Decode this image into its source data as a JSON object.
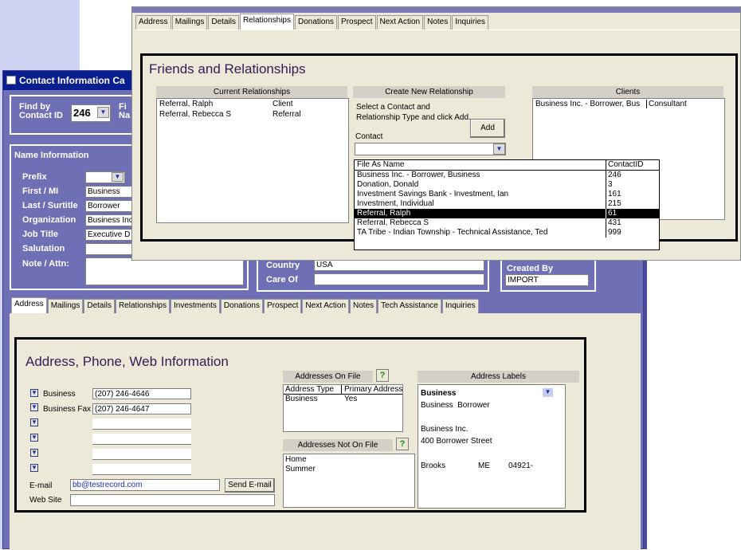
{
  "back_window": {
    "title": "Contact Information Ca",
    "find_by_label": "Find by\nContact ID",
    "find_by_value": "246",
    "find_by_name_label": "Fi\nNa",
    "name_section_title": "Name Information",
    "fields": [
      {
        "label": "Prefix",
        "value": ""
      },
      {
        "label": "First / MI",
        "value": "Business"
      },
      {
        "label": "Last / Surtitle",
        "value": "Borrower"
      },
      {
        "label": "Organization",
        "value": "Business Inc"
      },
      {
        "label": "Job Title",
        "value": "Executive D"
      },
      {
        "label": "Salutation",
        "value": ""
      },
      {
        "label": "Note / Attn:",
        "value": ""
      }
    ],
    "country_label": "Country",
    "country_value": "USA",
    "care_of_label": "Care Of",
    "care_of_value": "",
    "created_by_label": "Created By",
    "created_by_value": "IMPORT",
    "tabs": [
      "Address",
      "Mailings",
      "Details",
      "Relationships",
      "Investments",
      "Donations",
      "Prospect",
      "Next Action",
      "Notes",
      "Tech Assistance",
      "Inquiries"
    ],
    "active_tab": "Address",
    "address": {
      "heading": "Address, Phone, Web Information",
      "phones": [
        {
          "type": "Business",
          "number": "(207) 246-4646"
        },
        {
          "type": "Business Fax",
          "number": "(207) 246-4647"
        },
        {
          "type": "",
          "number": ""
        },
        {
          "type": "",
          "number": ""
        },
        {
          "type": "",
          "number": ""
        },
        {
          "type": "",
          "number": ""
        }
      ],
      "email_label": "E-mail",
      "email_value": "bb@testrecord.com",
      "send_email_label": "Send E-mail",
      "website_label": "Web Site",
      "website_value": "",
      "on_file_header": "Addresses On File",
      "on_file_columns": [
        "Address Type",
        "Primary Address"
      ],
      "on_file_rows": [
        [
          "Business",
          "Yes"
        ]
      ],
      "not_on_file_header": "Addresses Not On File",
      "not_on_file_rows": [
        "Home",
        "Summer"
      ],
      "help_label": "?",
      "labels_header": "Address Labels",
      "label_type": "Business",
      "label_lines": [
        "Business  Borrower",
        "",
        "Business Inc.",
        "400 Borrower Street",
        ""
      ],
      "label_city": "Brooks",
      "label_state": "ME",
      "label_zip": "04921-"
    }
  },
  "front_window": {
    "tabs": [
      "Address",
      "Mailings",
      "Details",
      "Relationships",
      "Donations",
      "Prospect",
      "Next Action",
      "Notes",
      "Inquiries"
    ],
    "active_tab": "Relationships",
    "heading": "Friends and Relationships",
    "current_header": "Current Relationships",
    "current_rows": [
      [
        "Referral, Ralph",
        "Client"
      ],
      [
        "Referral, Rebecca S",
        "Referral"
      ]
    ],
    "create_header": "Create New Relationship",
    "create_instructions": "Select a Contact and Relationship Type and click Add.",
    "add_label": "Add",
    "contact_label": "Contact",
    "contact_value": "",
    "clients_header": "Clients",
    "clients_rows": [
      [
        "Business Inc. - Borrower, Bus",
        "Consultant"
      ]
    ],
    "dropdown_columns": [
      "File As Name",
      "ContactID"
    ],
    "dropdown_rows": [
      [
        "Business Inc. - Borrower, Business",
        "246"
      ],
      [
        "Donation, Donald",
        "3"
      ],
      [
        "Investment Savings Bank - Investment, Ian",
        "161"
      ],
      [
        "Investment, Individual",
        "215"
      ],
      [
        "Referral, Ralph",
        "61"
      ],
      [
        "Referral, Rebecca S",
        "431"
      ],
      [
        "TA Tribe - Indian Township - Technical Assistance, Ted",
        "999"
      ]
    ],
    "dropdown_selected_index": 4
  }
}
